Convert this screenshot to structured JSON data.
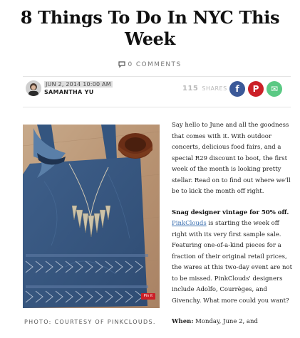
{
  "article": {
    "title": "8 Things To Do In NYC This Week",
    "comments": "0 COMMENTS",
    "date": "JUN 2, 2014 10:00 AM",
    "author": "SAMANTHA YU",
    "shares_count": "115",
    "shares_label": "SHARES"
  },
  "share_buttons": {
    "facebook": "f",
    "pinterest": "P",
    "email": "✉"
  },
  "photo": {
    "pin_label": "Pin it",
    "caption": "PHOTO: COURTESY OF PINKCLOUDS."
  },
  "body": {
    "intro": "Say hello to June and all the goodness that comes with it. With outdoor concerts, delicious food fairs, and a special R29 discount to boot, the first week of the month is looking pretty stellar. Read on to find out where we'll be to kick the month off right.",
    "section_title": "Snag designer vintage for 50% off.",
    "link_text": "PinkClouds",
    "section_text": " is starting the week off right with its very first sample sale. Featuring one-of-a-kind pieces for a fraction of their original retail prices, the wares at this two-day event are not to be missed. PinkClouds' designers include Adolfo, Courrèges, and Givenchy. What more could you want?",
    "when_label": "When:",
    "when_text": " Monday, June 2, and"
  },
  "colors": {
    "facebook": "#3b5998",
    "pinterest": "#cb2027",
    "email": "#5bc984",
    "link": "#3a6fb0"
  }
}
